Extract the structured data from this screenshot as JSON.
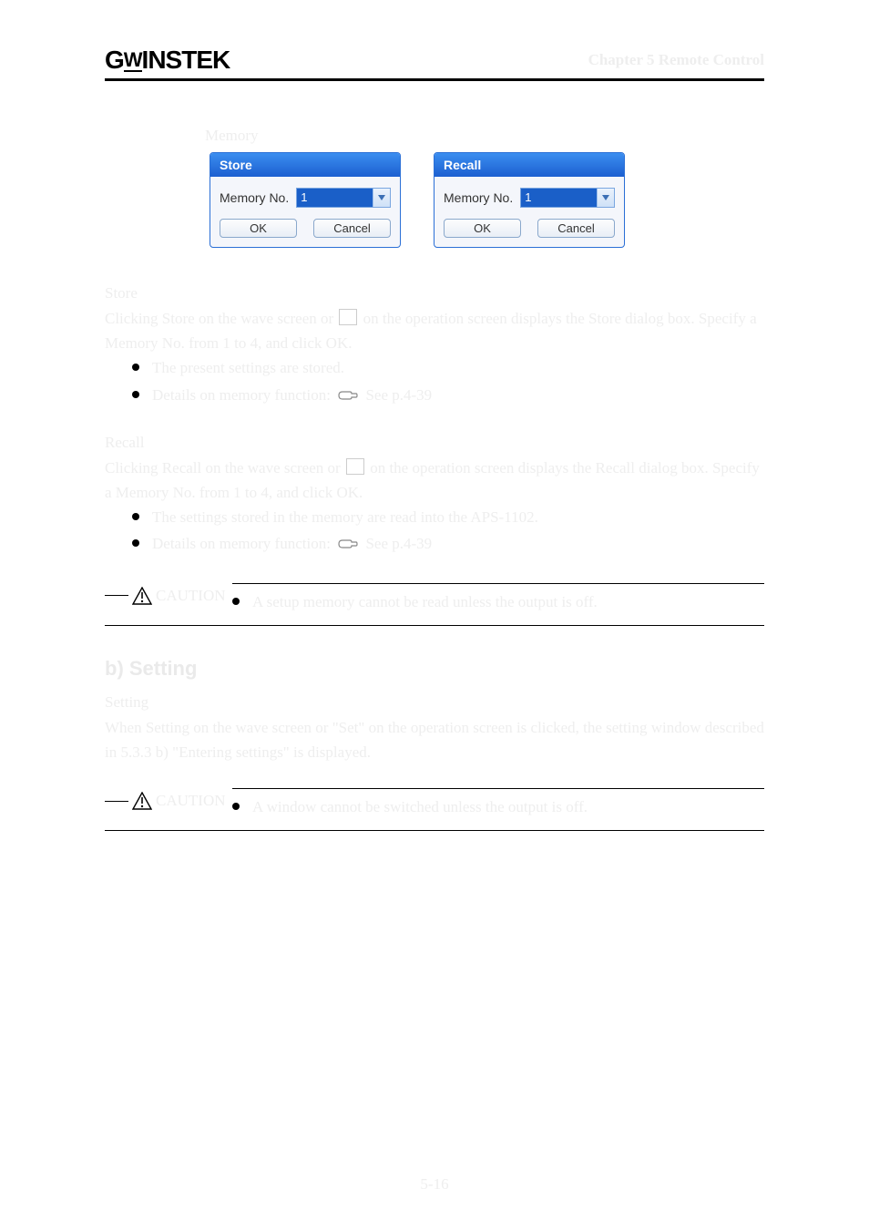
{
  "header": {
    "logo_text": "GWINSTEK",
    "chapter": "Chapter 5 Remote Control"
  },
  "memory_label": "Memory",
  "dialogs": {
    "store": {
      "title": "Store",
      "field_label": "Memory No.",
      "value": "1",
      "ok": "OK",
      "cancel": "Cancel"
    },
    "recall": {
      "title": "Recall",
      "field_label": "Memory No.",
      "value": "1",
      "ok": "OK",
      "cancel": "Cancel"
    }
  },
  "store_block": {
    "label": "Store",
    "p1_a": "Clicking Store on the wave screen or ",
    "p1_b": " on the operation screen displays the Store dialog box. Specify a Memory No. from 1 to 4, and click OK.",
    "bullets": [
      "The present settings are stored.",
      "Details on memory function:"
    ],
    "see": "See p.4-39"
  },
  "recall_block": {
    "label": "Recall",
    "p1_a": "Clicking Recall on the wave screen or ",
    "p1_b": " on the operation screen displays the Recall dialog box. Specify a Memory No. from 1 to 4, and click OK.",
    "bullets": [
      "The settings stored in the memory are read into the APS-1102.",
      "Details on memory function:"
    ],
    "see": "See p.4-39"
  },
  "caution1": {
    "label": "CAUTION",
    "text": "A setup memory cannot be read unless the output is off."
  },
  "setting_section": {
    "heading": "b) Setting",
    "label": "Setting",
    "para": "When Setting on the wave screen or \"Set\" on the operation screen is clicked, the setting window described in 5.3.3 b) \"Entering settings\" is displayed."
  },
  "caution2": {
    "label": "CAUTION",
    "text": "A window cannot be switched unless the output is off."
  },
  "page_number": "5-16"
}
